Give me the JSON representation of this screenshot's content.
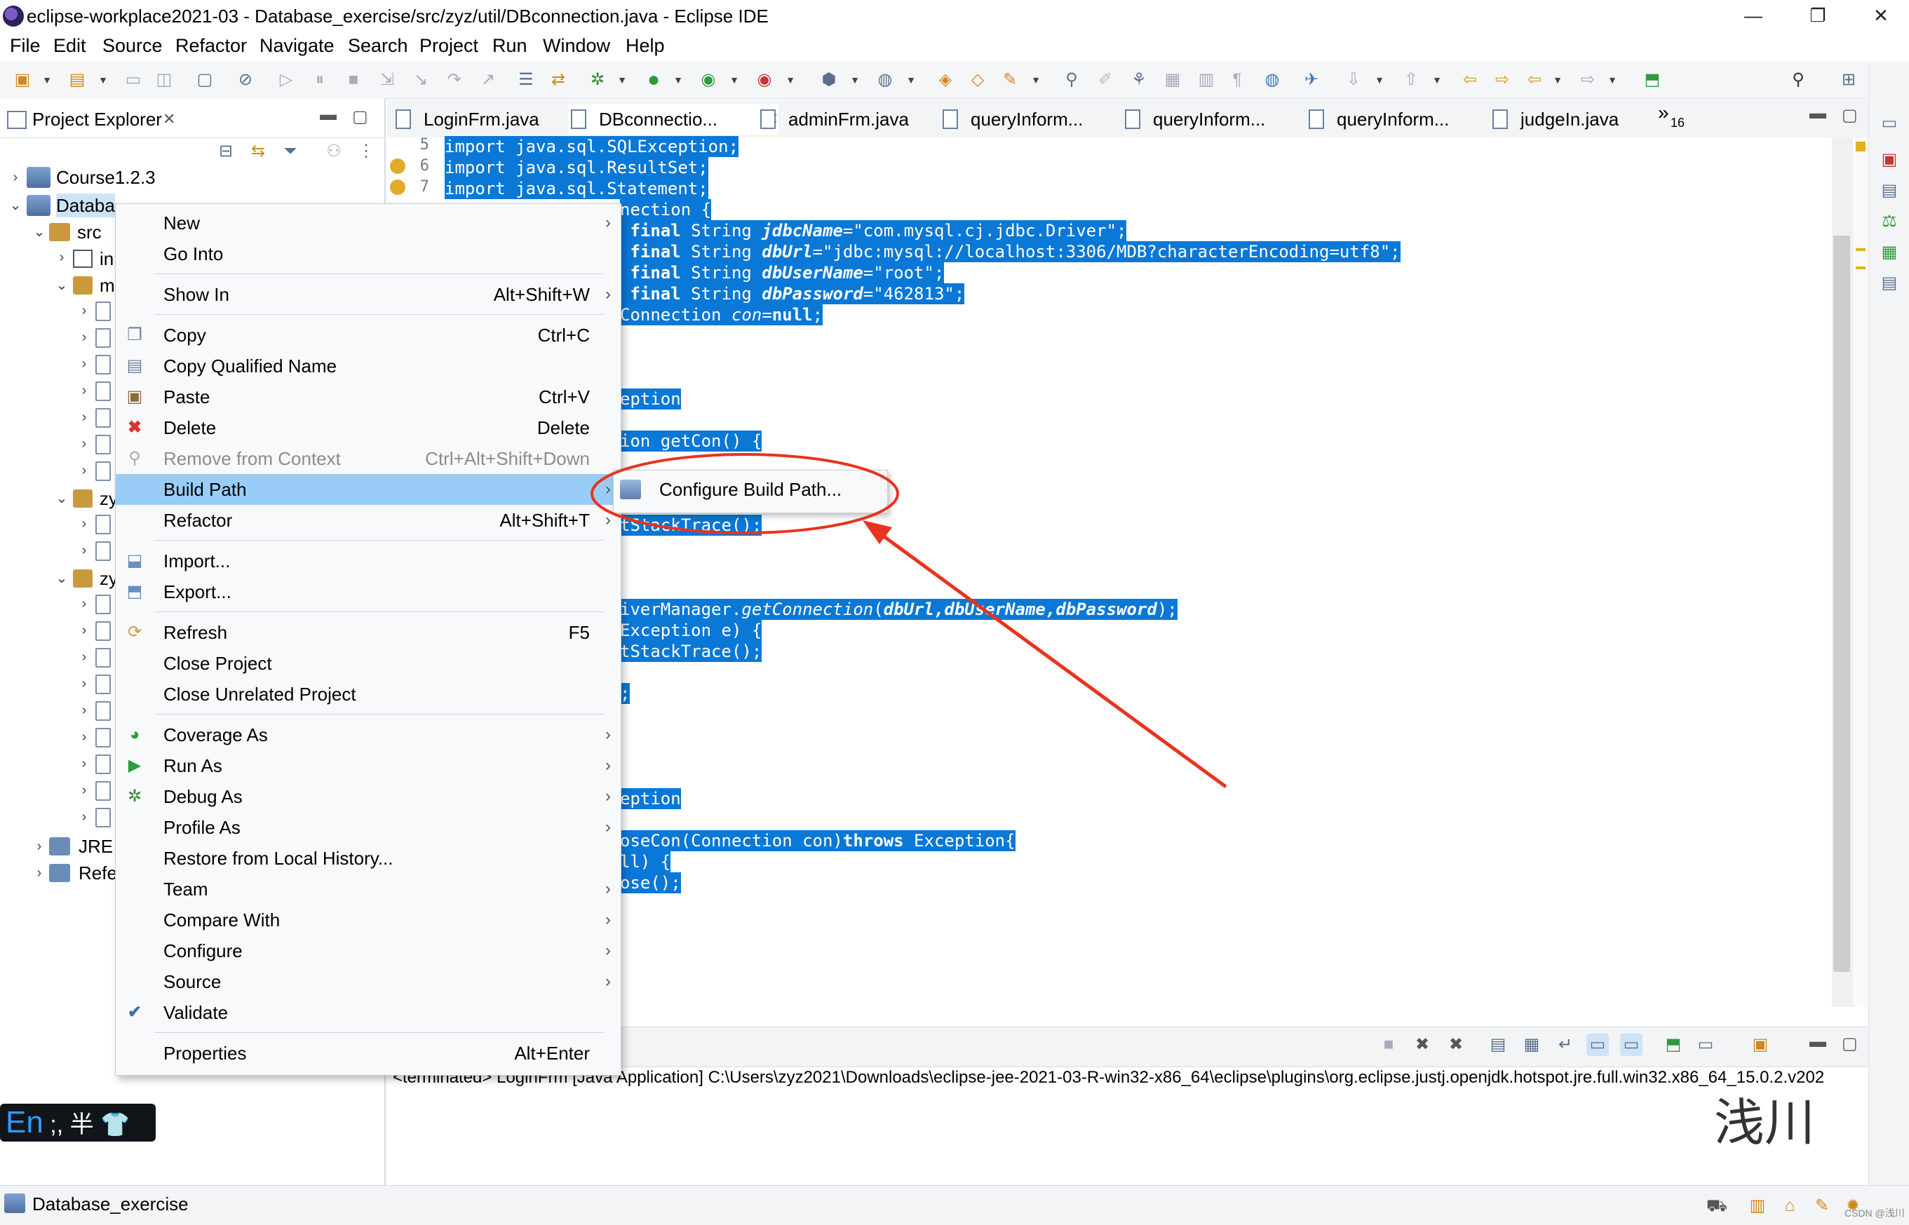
{
  "window": {
    "title": "eclipse-workplace2021-03 - Database_exercise/src/zyz/util/DBconnection.java - Eclipse IDE",
    "controls": {
      "minimize": "—",
      "restore": "❐",
      "close": "✕"
    }
  },
  "menubar": [
    "File",
    "Edit",
    "Source",
    "Refactor",
    "Navigate",
    "Search",
    "Project",
    "Run",
    "Window",
    "Help"
  ],
  "explorer": {
    "title": "Project Explorer",
    "close": "✕",
    "tree": {
      "course": "Course1.2.3",
      "database": "Databa",
      "src": "src",
      "pkg_in": "in",
      "pkg_m": "m",
      "pkg_zy1": "zy",
      "pkg_zy2": "zy",
      "jre": "JRE",
      "refs": "Refe"
    }
  },
  "editor": {
    "tabs": [
      "LoginFrm.java",
      "DBconnectio...",
      "adminFrm.java",
      "queryInform...",
      "queryInform...",
      "queryInform...",
      "judgeIn.java"
    ],
    "overflow": "»",
    "overflow_count": "16",
    "line_numbers": [
      "5",
      "6",
      "7"
    ],
    "code": {
      "l5": "import java.sql.SQLException;",
      "l6": "import java.sql.ResultSet;",
      "l7": "import java.sql.Statement;",
      "l8": "nection {",
      "l9_kw": " final",
      "l9_type": " String ",
      "l9_var": "jdbcName",
      "l9_val": "=\"com.mysql.cj.jdbc.Driver\";",
      "l10_kw": " final",
      "l10_type": " String ",
      "l10_var": "dbUrl",
      "l10_val": "=\"jdbc:mysql://localhost:3306/MDB?characterEncoding=utf8\";",
      "l11_kw": " final",
      "l11_type": " String ",
      "l11_var": "dbUserName",
      "l11_val": "=\"root\";",
      "l12_kw": " final",
      "l12_type": " String ",
      "l12_var": "dbPassword",
      "l12_val": "=\"462813\";",
      "l13_a": "Connection ",
      "l13_var": "con",
      "l13_b": "=",
      "l13_null": "null",
      "l13_c": ";",
      "l16": "eption",
      "l18": "ion getCon() {",
      "l21": "tStackTrace();",
      "l25_a": "iverManager.",
      "l25_m": "getConnection",
      "l25_b": "(",
      "l25_args": "dbUrl,dbUserName,dbPassword",
      "l25_c": ");",
      "l26": "Exception e) {",
      "l27": "tStackTrace();",
      "l29": ";",
      "l35": "eption",
      "l37_a": "oseCon(Connection con)",
      "l37_kw": "throws",
      "l37_b": " Exception{",
      "l38": "ll) {",
      "l39": "ose();"
    }
  },
  "context_menu": {
    "items": [
      {
        "label": "New",
        "shortcut": "",
        "submenu": true
      },
      {
        "label": "Go Into",
        "shortcut": "",
        "submenu": false
      },
      {
        "label": "Show In",
        "shortcut": "Alt+Shift+W",
        "submenu": true
      },
      {
        "label": "Copy",
        "shortcut": "Ctrl+C",
        "submenu": false
      },
      {
        "label": "Copy Qualified Name",
        "shortcut": "",
        "submenu": false
      },
      {
        "label": "Paste",
        "shortcut": "Ctrl+V",
        "submenu": false
      },
      {
        "label": "Delete",
        "shortcut": "Delete",
        "submenu": false
      },
      {
        "label": "Remove from Context",
        "shortcut": "Ctrl+Alt+Shift+Down",
        "submenu": false
      },
      {
        "label": "Build Path",
        "shortcut": "",
        "submenu": true
      },
      {
        "label": "Refactor",
        "shortcut": "Alt+Shift+T",
        "submenu": true
      },
      {
        "label": "Import...",
        "shortcut": "",
        "submenu": false
      },
      {
        "label": "Export...",
        "shortcut": "",
        "submenu": false
      },
      {
        "label": "Refresh",
        "shortcut": "F5",
        "submenu": false
      },
      {
        "label": "Close Project",
        "shortcut": "",
        "submenu": false
      },
      {
        "label": "Close Unrelated Project",
        "shortcut": "",
        "submenu": false
      },
      {
        "label": "Coverage As",
        "shortcut": "",
        "submenu": true
      },
      {
        "label": "Run As",
        "shortcut": "",
        "submenu": true
      },
      {
        "label": "Debug As",
        "shortcut": "",
        "submenu": true
      },
      {
        "label": "Profile As",
        "shortcut": "",
        "submenu": true
      },
      {
        "label": "Restore from Local History...",
        "shortcut": "",
        "submenu": false
      },
      {
        "label": "Team",
        "shortcut": "",
        "submenu": true
      },
      {
        "label": "Compare With",
        "shortcut": "",
        "submenu": true
      },
      {
        "label": "Configure",
        "shortcut": "",
        "submenu": true
      },
      {
        "label": "Source",
        "shortcut": "",
        "submenu": true
      },
      {
        "label": "Validate",
        "shortcut": "",
        "submenu": false
      },
      {
        "label": "Properties",
        "shortcut": "Alt+Enter",
        "submenu": false
      }
    ],
    "submenu_arrow": "›",
    "highlighted": "Build Path",
    "disabled": "Remove from Context",
    "checked": "Validate"
  },
  "submenu": {
    "item": "Configure Build Path..."
  },
  "console": {
    "text": "<terminated> LoginFrm [Java Application] C:\\Users\\zyz2021\\Downloads\\eclipse-jee-2021-03-R-win32-x86_64\\eclipse\\plugins\\org.eclipse.justj.openjdk.hotspot.jre.full.win32.x86_64_15.0.2.v202"
  },
  "ime": {
    "lang": "En",
    "rest": " ;, 半 👕"
  },
  "statusbar": {
    "project": "Database_exercise"
  },
  "watermark": "浅川",
  "csdn_mark": "CSDN @浅川",
  "colors": {
    "selection": "#0a78d7",
    "menu_highlight": "#99ccf7",
    "annotation": "#e8331f"
  },
  "icons": [
    "app-icon",
    "search-icon",
    "perspective-icon",
    "new-wizard-icon",
    "save-icon",
    "run-icon",
    "debug-icon"
  ]
}
